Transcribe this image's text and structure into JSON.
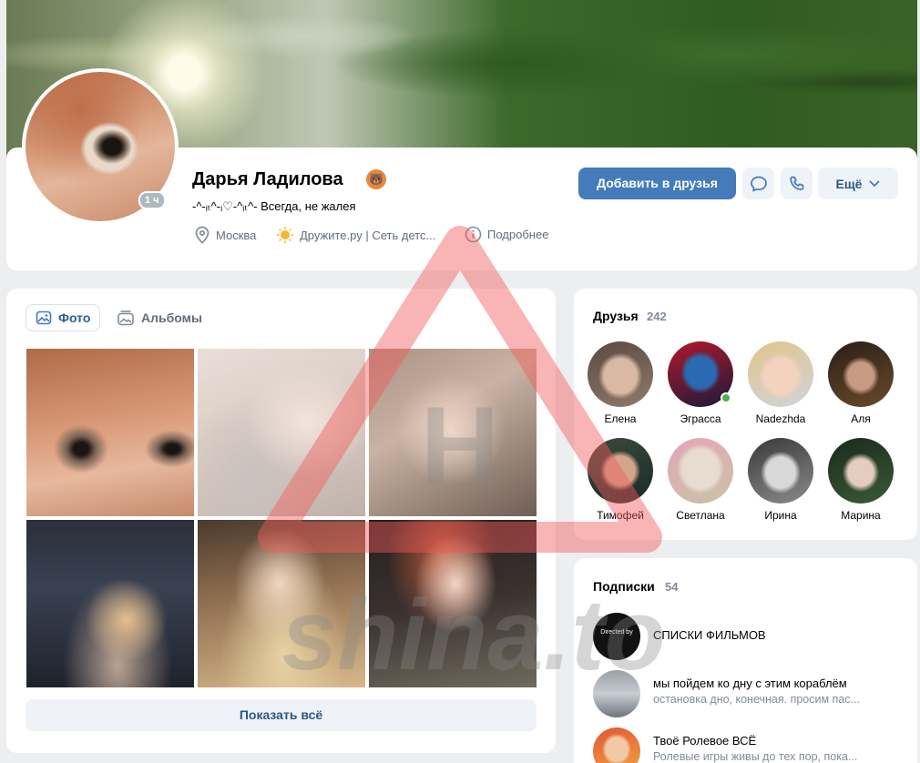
{
  "profile": {
    "name": "Дарья Ладилова",
    "status": "-^-ᵢₜ^-ᵢ♡-^ᵢₜ^- Всегда, не жалея",
    "online_badge": "1 ч",
    "city": "Москва",
    "community": "Дружите.ру | Сеть детс...",
    "more_info": "Подробнее"
  },
  "actions": {
    "add_friend": "Добавить в друзья",
    "more": "Ещё"
  },
  "photos": {
    "tab_photos": "Фото",
    "tab_albums": "Альбомы",
    "show_all": "Показать всё"
  },
  "friends": {
    "title": "Друзья",
    "count": "242",
    "items": [
      {
        "name": "Елена"
      },
      {
        "name": "Эграсса"
      },
      {
        "name": "Nadezhda"
      },
      {
        "name": "Аля"
      },
      {
        "name": "Тимофей"
      },
      {
        "name": "Светлана"
      },
      {
        "name": "Ирина"
      },
      {
        "name": "Марина"
      }
    ]
  },
  "subscriptions": {
    "title": "Подписки",
    "count": "54",
    "items": [
      {
        "title": "СПИСКИ ФИЛЬМОВ",
        "desc": "",
        "avatar_text": "Directed by"
      },
      {
        "title": "мы пойдем ко дну с этим кораблём",
        "desc": "остановка дно, конечная. просим пас..."
      },
      {
        "title": "Твоё Ролевое ВСЁ",
        "desc": "Ролевые игры живы до тех пор, пока..."
      }
    ]
  },
  "watermark": {
    "text": "shina.to",
    "letter": "Н"
  },
  "colors": {
    "accent": "#447bba",
    "link": "#2a5885",
    "online": "#4bb34b",
    "secondary_text": "#818c99",
    "page_bg": "#edeef0"
  },
  "icons": [
    "location-icon",
    "sun-icon",
    "info-icon",
    "message-icon",
    "phone-icon",
    "chevron-down-icon",
    "photo-icon",
    "album-icon"
  ]
}
